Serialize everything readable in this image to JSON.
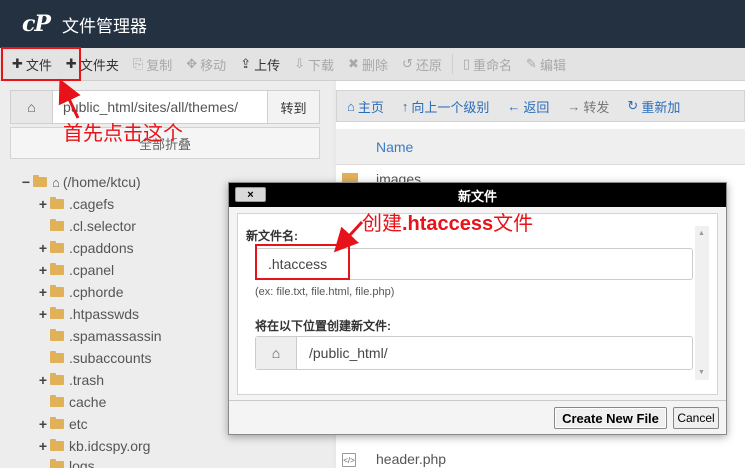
{
  "app": {
    "logo": "cP",
    "title": "文件管理器"
  },
  "toolbar": {
    "items": [
      {
        "icon": "plus-icon",
        "glyph": "✚",
        "label": "文件",
        "enabled": true
      },
      {
        "icon": "plus-icon",
        "glyph": "✚",
        "label": "文件夹",
        "enabled": true
      },
      {
        "icon": "copy-icon",
        "glyph": "⎘",
        "label": "复制",
        "enabled": false
      },
      {
        "icon": "move-icon",
        "glyph": "✥",
        "label": "移动",
        "enabled": false
      },
      {
        "icon": "upload-icon",
        "glyph": "⇪",
        "label": "上传",
        "enabled": true
      },
      {
        "icon": "download-icon",
        "glyph": "⇩",
        "label": "下载",
        "enabled": false
      },
      {
        "icon": "delete-icon",
        "glyph": "✖",
        "label": "删除",
        "enabled": false
      },
      {
        "icon": "restore-icon",
        "glyph": "↺",
        "label": "还原",
        "enabled": false
      },
      {
        "icon": "rename-icon",
        "glyph": "▯",
        "label": "重命名",
        "enabled": false
      },
      {
        "icon": "edit-icon",
        "glyph": "✎",
        "label": "编辑",
        "enabled": false
      }
    ]
  },
  "left": {
    "path_value": "public_html/sites/all/themes/",
    "go_label": "转到",
    "collapse_all_label": "全部折叠",
    "tree": [
      {
        "toggle": "−",
        "label": "(/home/ktcu)",
        "root": true
      },
      {
        "toggle": "+",
        "label": ".cagefs"
      },
      {
        "toggle": "",
        "label": ".cl.selector"
      },
      {
        "toggle": "+",
        "label": ".cpaddons"
      },
      {
        "toggle": "+",
        "label": ".cpanel"
      },
      {
        "toggle": "+",
        "label": ".cphorde"
      },
      {
        "toggle": "+",
        "label": ".htpasswds"
      },
      {
        "toggle": "",
        "label": ".spamassassin"
      },
      {
        "toggle": "",
        "label": ".subaccounts"
      },
      {
        "toggle": "+",
        "label": ".trash"
      },
      {
        "toggle": "",
        "label": "cache"
      },
      {
        "toggle": "+",
        "label": "etc"
      },
      {
        "toggle": "+",
        "label": "kb.idcspy.org"
      },
      {
        "toggle": "",
        "label": "logs"
      }
    ]
  },
  "right": {
    "toolbar": [
      {
        "icon": "home-icon",
        "glyph": "⌂",
        "label": "主页",
        "enabled": true
      },
      {
        "icon": "level-up-icon",
        "glyph": "↑",
        "label": "向上一个级别",
        "enabled": true
      },
      {
        "icon": "back-icon",
        "glyph": "←",
        "label": "返回",
        "enabled": true
      },
      {
        "icon": "forward-icon",
        "glyph": "→",
        "label": "转发",
        "enabled": false
      },
      {
        "icon": "reload-icon",
        "glyph": "↻",
        "label": "重新加",
        "enabled": true
      }
    ],
    "column_name": "Name",
    "files": [
      {
        "type": "folder",
        "name": "images"
      },
      {
        "type": "file",
        "name": "header.php"
      }
    ]
  },
  "dialog": {
    "title": "新文件",
    "close_label": "×",
    "filename_label": "新文件名:",
    "filename_value": ".htaccess",
    "hint": "(ex: file.txt, file.html, file.php)",
    "location_label": "将在以下位置创建新文件:",
    "location_value": "/public_html/",
    "create_label": "Create New File",
    "cancel_label": "Cancel"
  },
  "annotations": {
    "step1": "首先点击这个",
    "step2_prefix": "创建",
    "step2_bold": ".htaccess",
    "step2_suffix": "文件",
    "color": "#e8131a"
  }
}
